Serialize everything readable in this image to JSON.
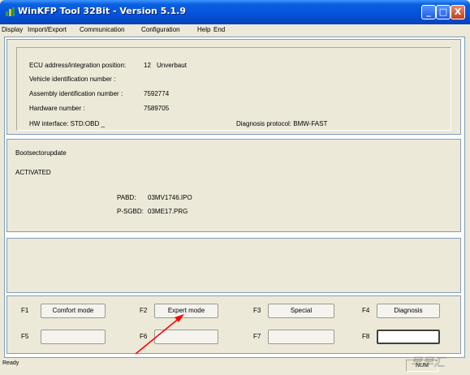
{
  "window": {
    "title": "WinKFP Tool 32Bit - Version 5.1.9",
    "controls": {
      "minimize": "_",
      "maximize": "□",
      "close": "X"
    }
  },
  "menu": [
    "Display",
    "Import/Export",
    "Communication",
    "Configuration",
    "Help",
    "End"
  ],
  "ecu_info": {
    "ecu_address_label": "ECU address/integration position:",
    "ecu_address_value": "12",
    "ecu_address_name": "Unverbaut",
    "vin_label": "Vehicle identification number :",
    "assembly_label": "Assembly identification number :",
    "assembly_value": "7592774",
    "hardware_label": "Hardware number :",
    "hardware_value": "7589705",
    "hw_interface": "HW interface:  STD:OBD  _",
    "diagnosis_protocol": "Diagnosis protocol:  BMW-FAST"
  },
  "boot": {
    "title": "Bootsectorupdate",
    "status": "ACTIVATED",
    "pabd_label": "PABD:",
    "pabd_value": "03MV1746.IPO",
    "psgbd_label": "P-SGBD:",
    "psgbd_value": "03ME17.PRG"
  },
  "function_keys": [
    {
      "key": "F1",
      "label": "Comfort mode"
    },
    {
      "key": "F2",
      "label": "Expert mode"
    },
    {
      "key": "F3",
      "label": "Special"
    },
    {
      "key": "F4",
      "label": "Diagnosis"
    },
    {
      "key": "F5",
      "label": ""
    },
    {
      "key": "F6",
      "label": ""
    },
    {
      "key": "F7",
      "label": ""
    },
    {
      "key": "F8",
      "label": ""
    }
  ],
  "status": {
    "text": "Ready",
    "num": "NUM"
  },
  "watermark": "早早汇",
  "annotation": {
    "arrow_color": "#ff0000"
  }
}
